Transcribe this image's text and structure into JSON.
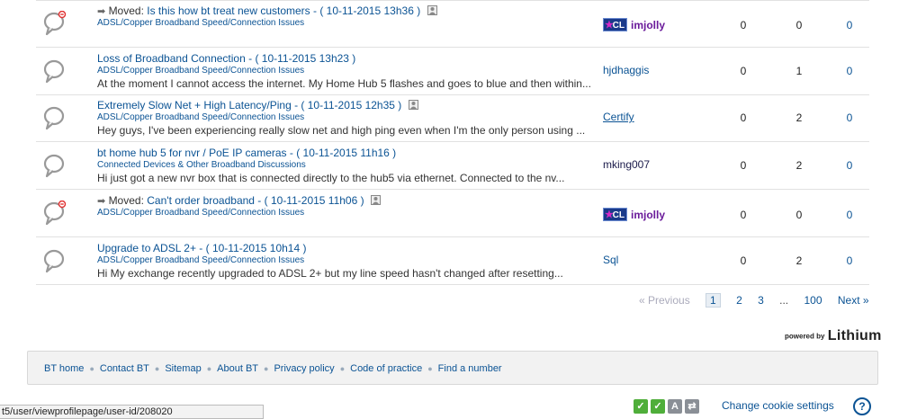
{
  "threads": [
    {
      "moved": true,
      "moved_label": "Moved:",
      "title": "Is this how bt treat new customers - ( 10-11-2015 13h36 )",
      "board": "ADSL/Copper Broadband Speed/Connection Issues",
      "preview": "",
      "author": "imjolly",
      "author_badge": "CL",
      "replies": "0",
      "kudos": "0",
      "views": "0",
      "icon": "chat-bubble-moved-icon"
    },
    {
      "moved": false,
      "title": "Loss of Broadband Connection - ( 10-11-2015 13h23 )",
      "board": "ADSL/Copper Broadband Speed/Connection Issues",
      "preview": "At the moment I cannot access the internet.  My Home Hub 5 flashes and goes to blue and then within...",
      "author": "hjdhaggis",
      "replies": "0",
      "kudos": "1",
      "views": "0",
      "icon": "chat-bubble-icon"
    },
    {
      "moved": false,
      "title": "Extremely Slow Net + High Latency/Ping - ( 10-11-2015 12h35 )",
      "board": "ADSL/Copper Broadband Speed/Connection Issues",
      "preview": "Hey guys, I've been experiencing really slow net and high ping even when I'm the only person using ...",
      "author": "Certify",
      "replies": "0",
      "kudos": "2",
      "views": "0",
      "icon": "chat-bubble-icon"
    },
    {
      "moved": false,
      "title": "bt home hub 5 for nvr / PoE IP cameras - ( 10-11-2015 11h16 )",
      "board": "Connected Devices & Other Broadband Discussions",
      "preview": "Hi just got a new nvr box that is connected directly to the hub5 via ethernet. Connected to the nv...",
      "author": "mking007",
      "replies": "0",
      "kudos": "2",
      "views": "0",
      "icon": "chat-bubble-icon"
    },
    {
      "moved": true,
      "moved_label": "Moved:",
      "title": "Can't order broadband - ( 10-11-2015 11h06 )",
      "board": "ADSL/Copper Broadband Speed/Connection Issues",
      "preview": "",
      "author": "imjolly",
      "author_badge": "CL",
      "replies": "0",
      "kudos": "0",
      "views": "0",
      "icon": "chat-bubble-moved-icon"
    },
    {
      "moved": false,
      "title": "Upgrade to ADSL 2+ - ( 10-11-2015 10h14 )",
      "board": "ADSL/Copper Broadband Speed/Connection Issues",
      "preview": "Hi   My exchange recently upgraded to ADSL 2+  but my line speed hasn't changed after resetting...",
      "author": "Sql",
      "replies": "0",
      "kudos": "2",
      "views": "0",
      "icon": "chat-bubble-icon"
    }
  ],
  "pagination": {
    "previous": "« Previous",
    "current": "1",
    "pages": [
      "2",
      "3"
    ],
    "ellipsis": "...",
    "last": "100",
    "next": "Next »"
  },
  "powered": {
    "by": "powered by",
    "brand": "Lithium"
  },
  "footer": {
    "links": [
      "BT home",
      "Contact BT",
      "Sitemap",
      "About BT",
      "Privacy policy",
      "Code of practice",
      "Find a number"
    ]
  },
  "status_url": "t5/user/viewprofilepage/user-id/208020",
  "cookie": {
    "label": "Change cookie settings",
    "badge_a": "A"
  },
  "help": "?",
  "colors": {
    "link": "#0b5394",
    "badge_bg": "#1a3a8a",
    "badge_star": "#d42ac8",
    "cookie_green": "#4fae3a"
  }
}
